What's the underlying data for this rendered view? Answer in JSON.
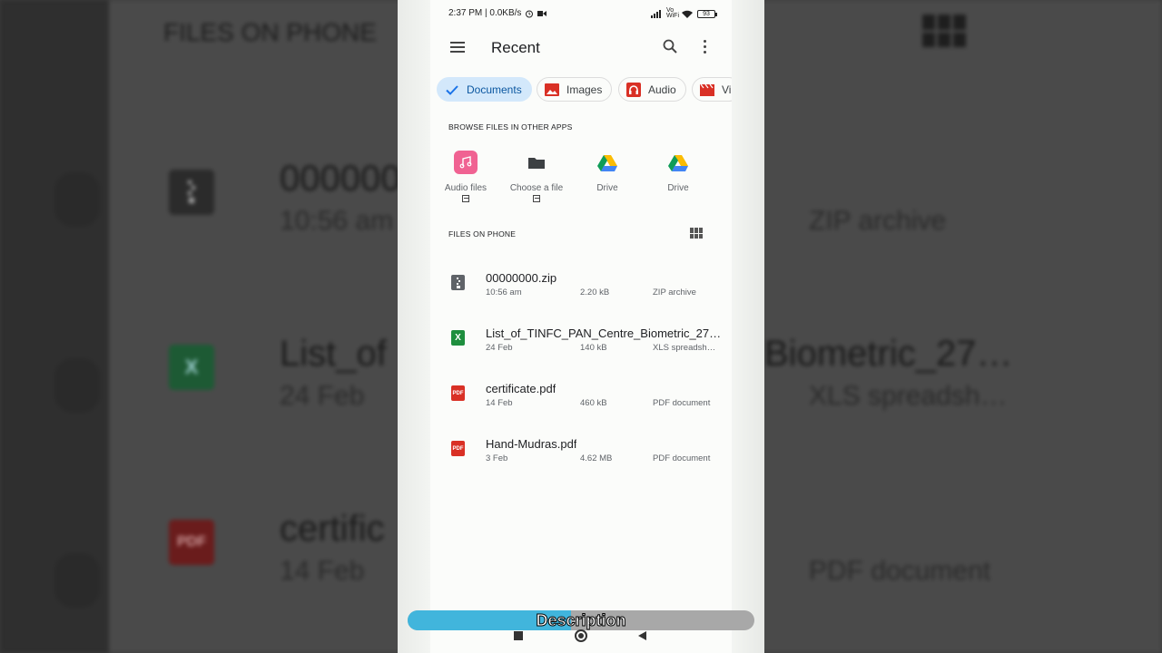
{
  "background": {
    "section_title": "FILES ON PHONE",
    "rows": [
      {
        "name": "000000",
        "date": "10:56 am",
        "type": "ZIP archive",
        "icon": "zip-icon"
      },
      {
        "name": "List_of",
        "name_right": "Biometric_27…",
        "date": "24 Feb",
        "type": "XLS spreadsh…",
        "icon": "xls-icon",
        "glyph": "X"
      },
      {
        "name": "certific",
        "date": "14 Feb",
        "type": "PDF document",
        "icon": "pdf-icon",
        "glyph": "PDF"
      }
    ]
  },
  "status_bar": {
    "time_speed": "2:37 PM | 0.0KB/s",
    "volte": "Vo WiFi",
    "battery": "93"
  },
  "app_bar": {
    "title": "Recent"
  },
  "chips": [
    {
      "label": "Documents",
      "icon": "check-icon",
      "selected": true
    },
    {
      "label": "Images",
      "icon": "image-icon",
      "selected": false
    },
    {
      "label": "Audio",
      "icon": "headphones-icon",
      "selected": false
    },
    {
      "label": "Vi",
      "icon": "video-icon",
      "selected": false
    }
  ],
  "browse_section": {
    "label": "BROWSE FILES IN OTHER APPS",
    "apps": [
      {
        "label": "Audio files",
        "icon": "music-note-icon",
        "external": true
      },
      {
        "label": "Choose a file",
        "icon": "folder-icon",
        "external": true
      },
      {
        "label": "Drive",
        "icon": "google-drive-icon",
        "external": false
      },
      {
        "label": "Drive",
        "icon": "google-drive-icon",
        "external": false
      }
    ]
  },
  "files_section": {
    "label": "FILES ON PHONE",
    "view_toggle_icon": "grid-view-icon",
    "files": [
      {
        "name": "00000000.zip",
        "date": "10:56 am",
        "size": "2.20 kB",
        "type": "ZIP archive",
        "icon": "zip-icon",
        "color": "#5f6368",
        "glyph": ""
      },
      {
        "name": "List_of_TINFC_PAN_Centre_Biometric_27…",
        "date": "24 Feb",
        "size": "140 kB",
        "type": "XLS spreadsh…",
        "icon": "xls-icon",
        "color": "#1e8e3e",
        "glyph": "X"
      },
      {
        "name": "certificate.pdf",
        "date": "14 Feb",
        "size": "460 kB",
        "type": "PDF document",
        "icon": "pdf-icon",
        "color": "#d93025",
        "glyph": "PDF"
      },
      {
        "name": "Hand-Mudras.pdf",
        "date": "3 Feb",
        "size": "4.62 MB",
        "type": "PDF document",
        "icon": "pdf-icon",
        "color": "#d93025",
        "glyph": "PDF"
      }
    ]
  },
  "overlay": {
    "description_label": "Description",
    "progress": 0.47
  }
}
